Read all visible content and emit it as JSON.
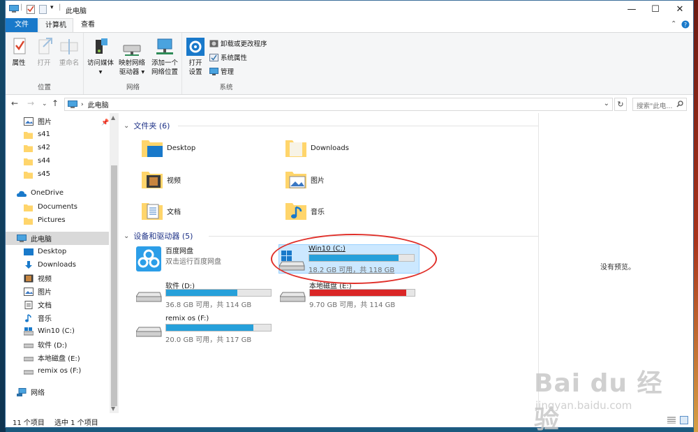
{
  "window": {
    "title": "此电脑",
    "controls": {
      "minimize": "—",
      "maximize": "☐",
      "close": "✕"
    }
  },
  "tabs": {
    "file": "文件",
    "computer": "计算机",
    "view": "查看"
  },
  "ribbon": {
    "location_group": {
      "title": "位置",
      "properties": "属性",
      "open": "打开",
      "rename": "重命名"
    },
    "network_group": {
      "title": "网络",
      "access_media": [
        "访问媒体",
        "▾"
      ],
      "map_drive": [
        "映射网络",
        "驱动器 ▾"
      ],
      "add_location": [
        "添加一个",
        "网络位置"
      ]
    },
    "system_group": {
      "title": "系统",
      "open_settings": [
        "打开",
        "设置"
      ],
      "uninstall": "卸载或更改程序",
      "system_properties": "系统属性",
      "manage": "管理"
    }
  },
  "address": {
    "path": "此电脑",
    "search_placeholder": "搜索\"此电...",
    "refresh": "↻"
  },
  "nav": {
    "quick": [
      "图片",
      "s41",
      "s42",
      "s44",
      "s45"
    ],
    "onedrive": "OneDrive",
    "onedrive_items": [
      "Documents",
      "Pictures"
    ],
    "this_pc": "此电脑",
    "pc_items": [
      "Desktop",
      "Downloads",
      "视频",
      "图片",
      "文档",
      "音乐",
      "Win10 (C:)",
      "软件 (D:)",
      "本地磁盘 (E:)",
      "remix os (F:)"
    ],
    "network": "网络"
  },
  "content": {
    "folders_header": "文件夹 (6)",
    "folders": [
      "Desktop",
      "Downloads",
      "视频",
      "图片",
      "文档",
      "音乐"
    ],
    "devices_header": "设备和驱动器 (5)",
    "baidu": {
      "name": "百度网盘",
      "sub": "双击运行百度网盘"
    },
    "drives": [
      {
        "name": "Win10 (C:)",
        "info": "18.2 GB 可用，共 118 GB",
        "used": 0.85,
        "color": "#26a0da"
      },
      {
        "name": "软件 (D:)",
        "info": "36.8 GB 可用，共 114 GB",
        "used": 0.68,
        "color": "#26a0da"
      },
      {
        "name": "本地磁盘 (E:)",
        "info": "9.70 GB 可用，共 114 GB",
        "used": 0.92,
        "color": "#da2626"
      },
      {
        "name": "remix os (F:)",
        "info": "20.0 GB 可用，共 117 GB",
        "used": 0.83,
        "color": "#26a0da"
      }
    ]
  },
  "preview": {
    "text": "没有预览。"
  },
  "status": {
    "count": "11 个项目",
    "selected": "选中 1 个项目"
  },
  "watermark": {
    "logo": "Bai du 经验",
    "url": "jingyan.baidu.com"
  },
  "colors": {
    "accent": "#1979ca",
    "annotation": "#e0302a",
    "drive_bar": "#26a0da",
    "drive_bar_full": "#da2626"
  }
}
